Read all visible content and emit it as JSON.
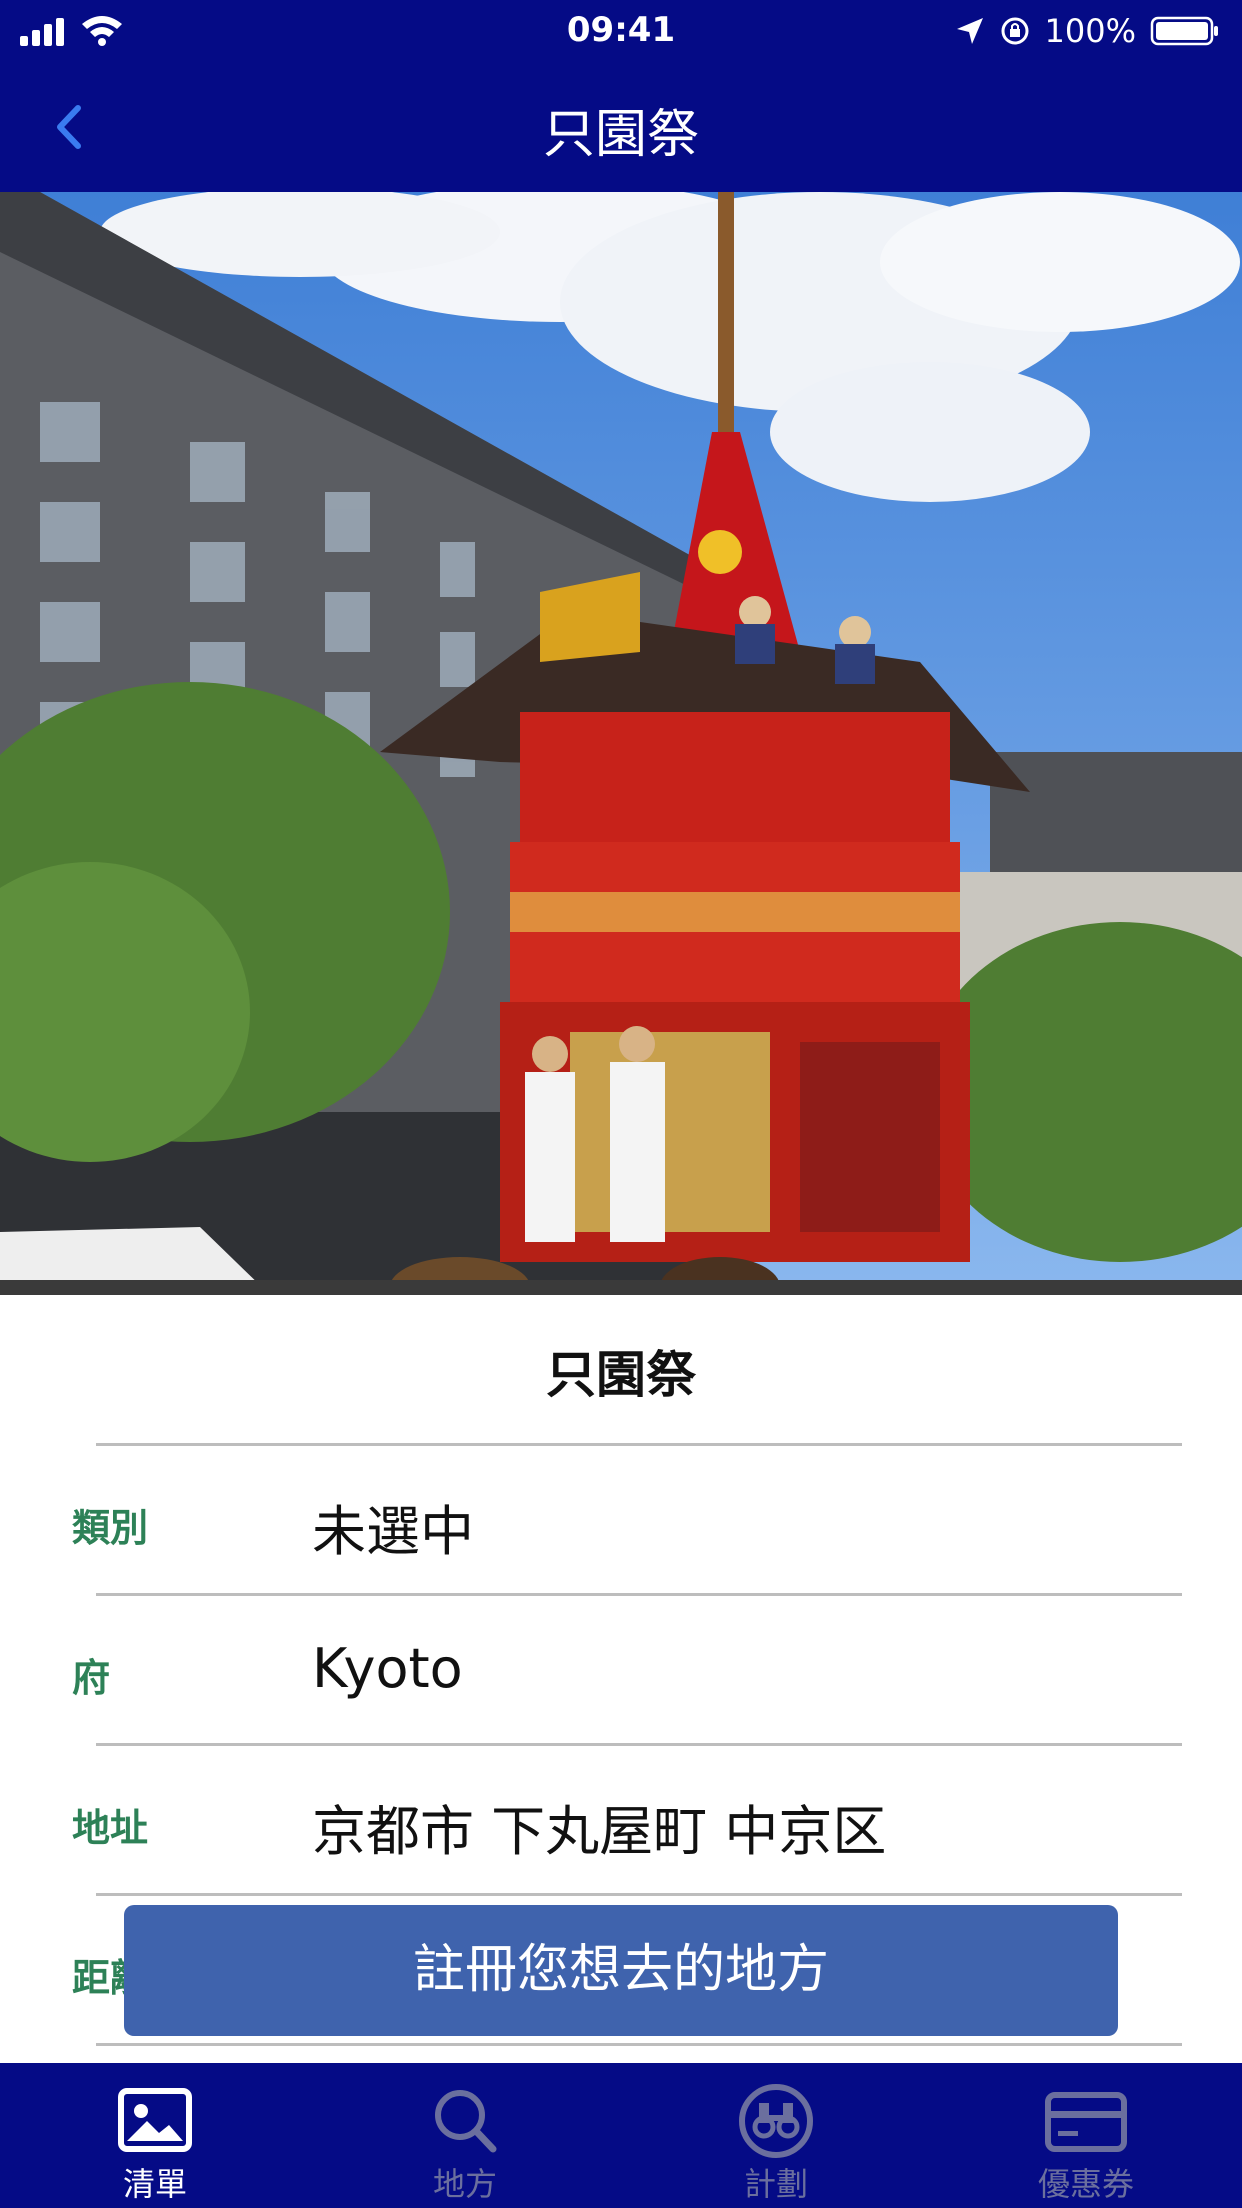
{
  "status_bar": {
    "time": "09:41",
    "battery": "100%"
  },
  "nav": {
    "title": "只園祭",
    "back_icon": "chevron-left-icon"
  },
  "detail": {
    "title": "只園祭",
    "rows": [
      {
        "label": "類別",
        "value": "未選中"
      },
      {
        "label": "府",
        "value": "Kyoto"
      },
      {
        "label": "地址",
        "value": "京都市 下丸屋町 中京区"
      },
      {
        "label": "距離",
        "value": ""
      }
    ]
  },
  "cta": {
    "label": "註冊您想去的地方"
  },
  "tabs": [
    {
      "label": "清單",
      "icon": "photo-icon",
      "active": true
    },
    {
      "label": "地方",
      "icon": "search-icon",
      "active": false
    },
    {
      "label": "計劃",
      "icon": "binoculars-icon",
      "active": false
    },
    {
      "label": "優惠券",
      "icon": "card-icon",
      "active": false
    }
  ],
  "colors": {
    "nav_bg": "#050b86",
    "accent_button": "#3f63ad",
    "label_green": "#2d8157",
    "back_arrow": "#3a7bf0"
  }
}
